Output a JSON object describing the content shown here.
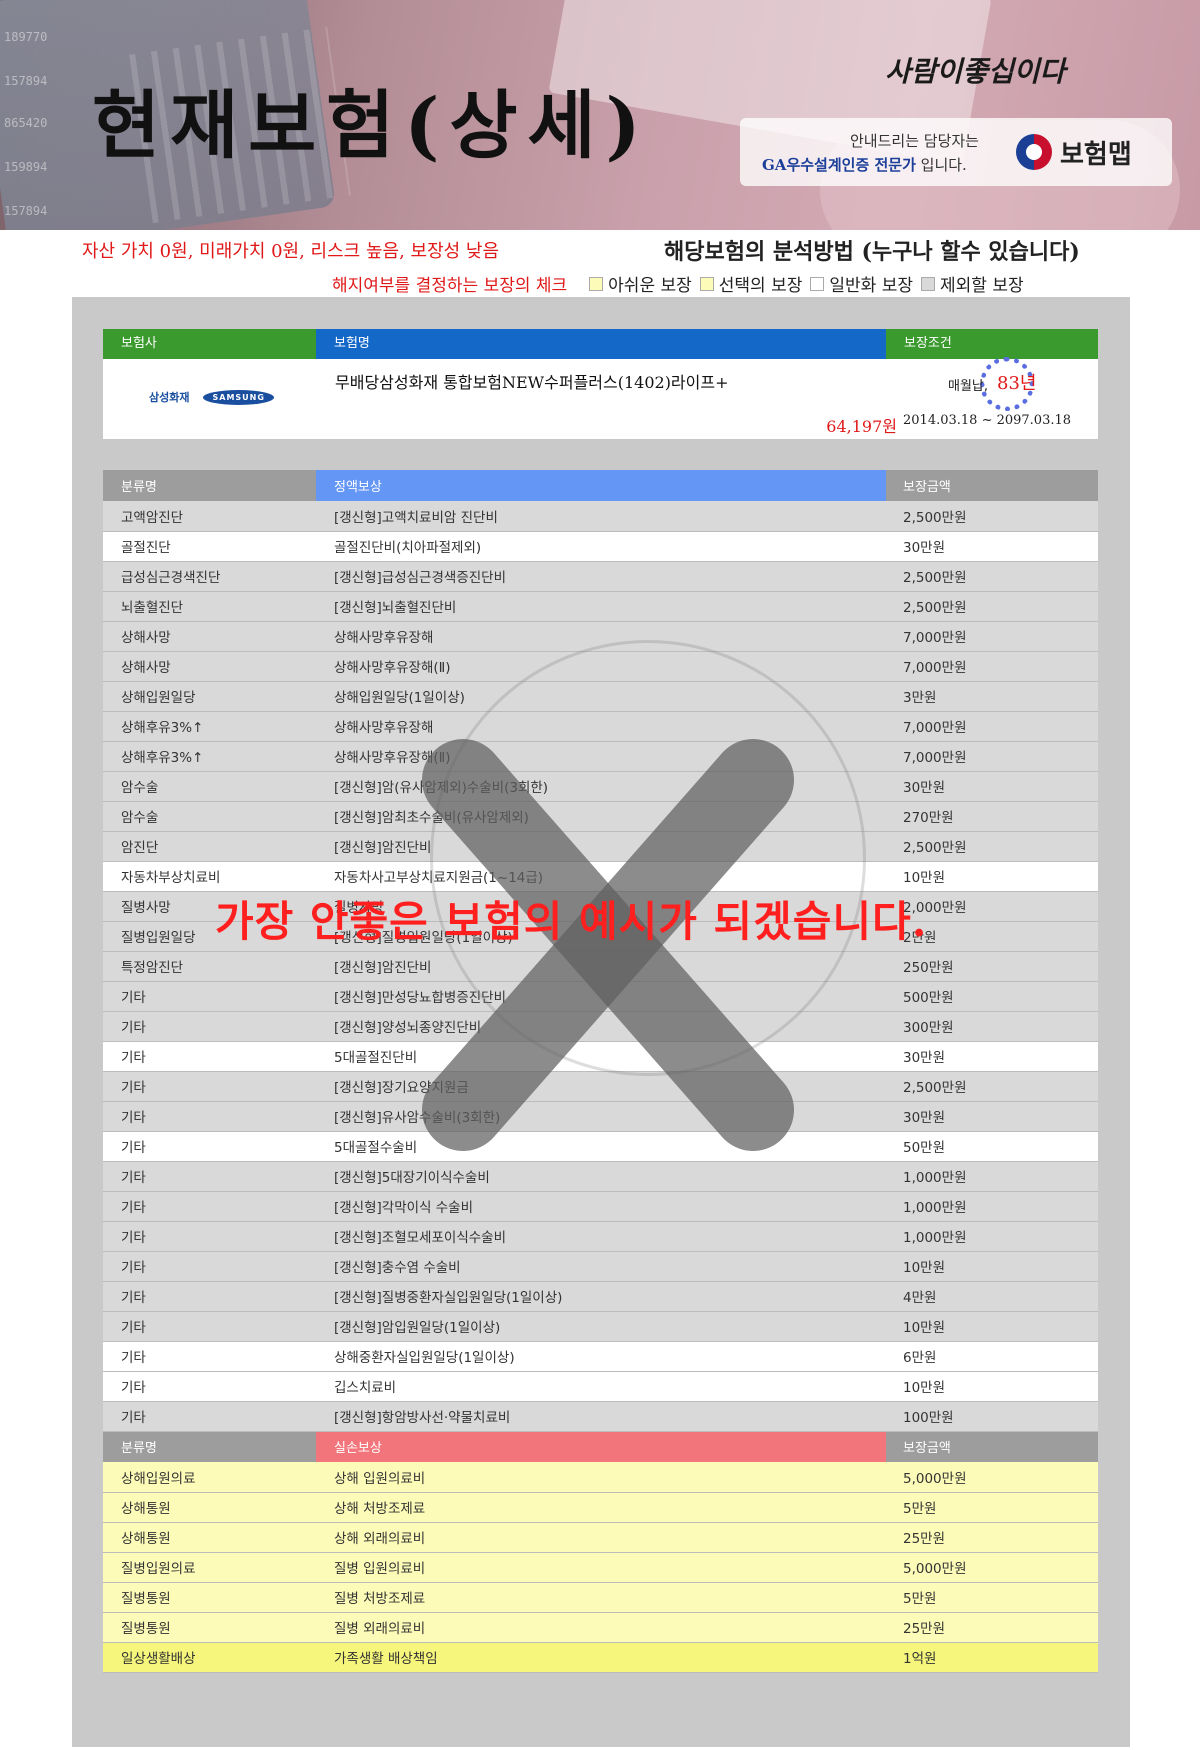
{
  "banner": {
    "title": "현재보험(상세)",
    "slogan": "사람이좋십이다",
    "agent_line1": "안내드리는 담당자는",
    "agent_highlight": "GA우수설계인증 전문가",
    "agent_line2_suffix": " 입니다.",
    "brand_name": "보험맵",
    "bg_ticks": [
      "189770",
      "157894",
      "865420",
      "159894",
      "157894"
    ]
  },
  "warning_text": "자산 가치 0원, 미래가치 0원, 리스크 높음, 보장성 낮음",
  "method_title": "해당보험의 분석방법 (누구나 할수 있습니다)",
  "legend": {
    "lead": "해지여부를 결정하는 보장의 체크",
    "items": [
      {
        "label": "아쉬운 보장",
        "color": "#fcfcb8"
      },
      {
        "label": "선택의 보장",
        "color": "#fcfcb8"
      },
      {
        "label": "일반화 보장",
        "color": "#ffffff"
      },
      {
        "label": "제외할 보장",
        "color": "#d9d9d9"
      }
    ]
  },
  "info": {
    "headers": {
      "insurer": "보험사",
      "product": "보험명",
      "condition": "보장조건"
    },
    "insurer_kr": "삼성화재",
    "insurer_en": "SAMSUNG",
    "product_name": "무배당삼성화재 통합보험NEW수퍼플러스(1402)라이프+",
    "premium": "64,197원",
    "pay_label": "매월납,",
    "pay_years": "83년",
    "period": "2014.03.18 ~ 2097.03.18"
  },
  "fixed_header": {
    "category": "분류명",
    "name": "정액보상",
    "amount": "보장금액"
  },
  "fixed_rows": [
    {
      "category": "  고액암진단",
      "name": "[갱신형]고액치료비암 진단비",
      "amount": "2,500만원",
      "style": "g"
    },
    {
      "category": "골절진단",
      "name": "골절진단비(치아파절제외)",
      "amount": "30만원",
      "style": "w"
    },
    {
      "category": "급성심근경색진단",
      "name": "[갱신형]급성심근경색증진단비",
      "amount": "2,500만원",
      "style": "g"
    },
    {
      "category": "뇌출혈진단",
      "name": "[갱신형]뇌출혈진단비",
      "amount": "2,500만원",
      "style": "g"
    },
    {
      "category": "상해사망",
      "name": "상해사망후유장해",
      "amount": "7,000만원",
      "style": "g"
    },
    {
      "category": "상해사망",
      "name": "상해사망후유장해(Ⅱ)",
      "amount": "7,000만원",
      "style": "g"
    },
    {
      "category": "상해입원일당",
      "name": "상해입원일당(1일이상)",
      "amount": "3만원",
      "style": "g"
    },
    {
      "category": "상해후유3%↑",
      "name": "상해사망후유장해",
      "amount": "7,000만원",
      "style": "g"
    },
    {
      "category": "상해후유3%↑",
      "name": "상해사망후유장해(Ⅱ)",
      "amount": "7,000만원",
      "style": "g"
    },
    {
      "category": "암수술",
      "name": "[갱신형]암(유사암제외)수술비(3회한)",
      "amount": "30만원",
      "style": "g"
    },
    {
      "category": "암수술",
      "name": "[갱신형]암최초수술비(유사암제외)",
      "amount": "270만원",
      "style": "g"
    },
    {
      "category": "암진단",
      "name": "[갱신형]암진단비",
      "amount": "2,500만원",
      "style": "g"
    },
    {
      "category": "자동차부상치료비",
      "name": "자동차사고부상치료지원금(1~14급)",
      "amount": "10만원",
      "style": "w"
    },
    {
      "category": "질병사망",
      "name": "질병사망",
      "amount": "2,000만원",
      "style": "g"
    },
    {
      "category": "질병입원일당",
      "name": "[갱신형]질병입원일당(1일이상)",
      "amount": "2만원",
      "style": "g"
    },
    {
      "category": "특정암진단",
      "name": "[갱신형]암진단비",
      "amount": "250만원",
      "style": "g"
    },
    {
      "category": "기타",
      "name": "[갱신형]만성당뇨합병증진단비",
      "amount": "500만원",
      "style": "g"
    },
    {
      "category": "기타",
      "name": "[갱신형]양성뇌종양진단비",
      "amount": "300만원",
      "style": "g"
    },
    {
      "category": "기타",
      "name": "5대골절진단비",
      "amount": "30만원",
      "style": "w"
    },
    {
      "category": "기타",
      "name": "[갱신형]장기요양지원금",
      "amount": "2,500만원",
      "style": "g"
    },
    {
      "category": "기타",
      "name": "[갱신형]유사암수술비(3회한)",
      "amount": "30만원",
      "style": "g"
    },
    {
      "category": "기타",
      "name": "5대골절수술비",
      "amount": "50만원",
      "style": "w"
    },
    {
      "category": "기타",
      "name": "[갱신형]5대장기이식수술비",
      "amount": "1,000만원",
      "style": "g"
    },
    {
      "category": "기타",
      "name": "[갱신형]각막이식 수술비",
      "amount": "1,000만원",
      "style": "g"
    },
    {
      "category": "기타",
      "name": "[갱신형]조혈모세포이식수술비",
      "amount": "1,000만원",
      "style": "g"
    },
    {
      "category": "기타",
      "name": "[갱신형]충수염 수술비",
      "amount": "10만원",
      "style": "g"
    },
    {
      "category": "기타",
      "name": "[갱신형]질병중환자실입원일당(1일이상)",
      "amount": "4만원",
      "style": "g"
    },
    {
      "category": "기타",
      "name": "[갱신형]암입원일당(1일이상)",
      "amount": "10만원",
      "style": "g"
    },
    {
      "category": "기타",
      "name": "상해중환자실입원일당(1일이상)",
      "amount": "6만원",
      "style": "w"
    },
    {
      "category": "기타",
      "name": "깁스치료비",
      "amount": "10만원",
      "style": "w"
    },
    {
      "category": "기타",
      "name": "[갱신형]항암방사선·약물치료비",
      "amount": "100만원",
      "style": "g"
    }
  ],
  "loss_header": {
    "category": "분류명",
    "name": "실손보상",
    "amount": "보장금액"
  },
  "loss_rows": [
    {
      "category": "상해입원의료",
      "name": "상해 입원의료비",
      "amount": "5,000만원",
      "style": "y"
    },
    {
      "category": "상해통원",
      "name": "상해 처방조제료",
      "amount": "5만원",
      "style": "y"
    },
    {
      "category": "상해통원",
      "name": "상해 외래의료비",
      "amount": "25만원",
      "style": "y"
    },
    {
      "category": "질병입원의료",
      "name": "질병 입원의료비",
      "amount": "5,000만원",
      "style": "y"
    },
    {
      "category": "질병통원",
      "name": "질병 처방조제료",
      "amount": "5만원",
      "style": "y"
    },
    {
      "category": "질병통원",
      "name": "질병 외래의료비",
      "amount": "25만원",
      "style": "y"
    },
    {
      "category": "일상생활배상",
      "name": "가족생활 배상책임",
      "amount": "1억원",
      "style": "yy"
    }
  ],
  "overlay_message": "가장 안좋은 보험의 예시가 되겠습니다.",
  "colors": {
    "header_green": "#3a9a2e",
    "header_blue": "#1468c8",
    "fixed_blue": "#6496f5",
    "loss_red": "#f2757b",
    "warning_red": "#e01818"
  }
}
